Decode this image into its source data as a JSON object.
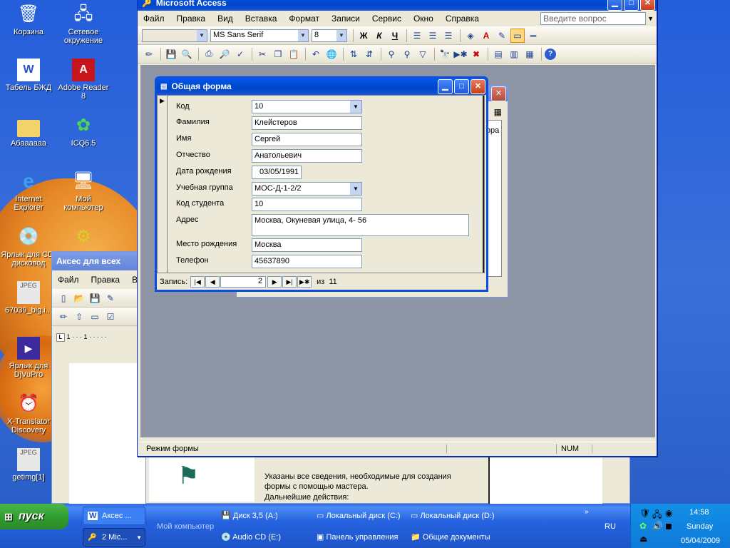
{
  "desktop_icons": [
    {
      "label": "Корзина",
      "icon": "recycle-bin-icon"
    },
    {
      "label": "Сетевое окружение",
      "icon": "network-icon"
    },
    {
      "label": "Табель БЖД",
      "icon": "word-doc-icon"
    },
    {
      "label": "Adobe Reader 8",
      "icon": "adobe-icon"
    },
    {
      "label": "Абаааааа",
      "icon": "folder-icon"
    },
    {
      "label": "ICQ6.5",
      "icon": "icq-icon"
    },
    {
      "label": "Internet Explorer",
      "icon": "ie-icon"
    },
    {
      "label": "Мой компьютер",
      "icon": "computer-icon"
    },
    {
      "label": "Ярлык для CD-дисковод",
      "icon": "cd-icon"
    },
    {
      "label": "67039_big.i...",
      "icon": "jpeg-icon"
    },
    {
      "label": "Ярлык для DjVuPro",
      "icon": "djvu-icon"
    },
    {
      "label": "X-Translator Discovery",
      "icon": "translator-icon"
    },
    {
      "label": "getimg[1]",
      "icon": "jpeg-icon"
    }
  ],
  "word_window": {
    "title": "Аксес для всех",
    "menu": [
      "Файл",
      "Правка",
      "В"
    ],
    "ruler_text": "1 · · · 1 · · · · ·"
  },
  "wizard_window": {
    "text1": "Указаны все сведения, необходимые для создания формы с помощью мастера.",
    "text2": "Дальнейшие действия:"
  },
  "access_window": {
    "title": "Microsoft Access",
    "menu": [
      "Файл",
      "Правка",
      "Вид",
      "Вставка",
      "Формат",
      "Записи",
      "Сервис",
      "Окно",
      "Справка"
    ],
    "help_placeholder": "Введите вопрос",
    "font_name": "MS Sans Serif",
    "font_size": "8",
    "bold": "Ж",
    "italic": "К",
    "underline": "Ч",
    "status_text": "Режим формы",
    "status_num": "NUM",
    "back_window_text": "тора"
  },
  "form": {
    "title": "Общая форма",
    "fields": [
      {
        "label": "Код",
        "value": "10"
      },
      {
        "label": "Фамилия",
        "value": "Клейстеров"
      },
      {
        "label": "Имя",
        "value": "Сергей"
      },
      {
        "label": "Отчество",
        "value": "Анатольевич"
      },
      {
        "label": "Дата рождения",
        "value": "03/05/1991"
      },
      {
        "label": "Учебная группа",
        "value": "МОС-Д-1-2/2"
      },
      {
        "label": "Код студента",
        "value": "10"
      },
      {
        "label": "Адрес",
        "value": "Москва, Окуневая улица, 4- 56"
      },
      {
        "label": "Место рождения",
        "value": "Москва"
      },
      {
        "label": "Телефон",
        "value": "45637890"
      }
    ],
    "nav": {
      "label": "Запись:",
      "current": "2",
      "of_label": "из",
      "total": "11"
    }
  },
  "taskbar": {
    "start_label": "пуск",
    "tasks": [
      "Аксес ...",
      "2 Mic..."
    ],
    "quicklaunch_header": "Мой компьютер",
    "quicklaunch": [
      "Диск 3,5 (A:)",
      "Локальный диск (C:)",
      "Локальный диск (D:)",
      "Audio CD (E:)",
      "Панель управления",
      "Общие документы"
    ],
    "language": "RU",
    "time": "14:58",
    "day": "Sunday",
    "date": "05/04/2009"
  }
}
